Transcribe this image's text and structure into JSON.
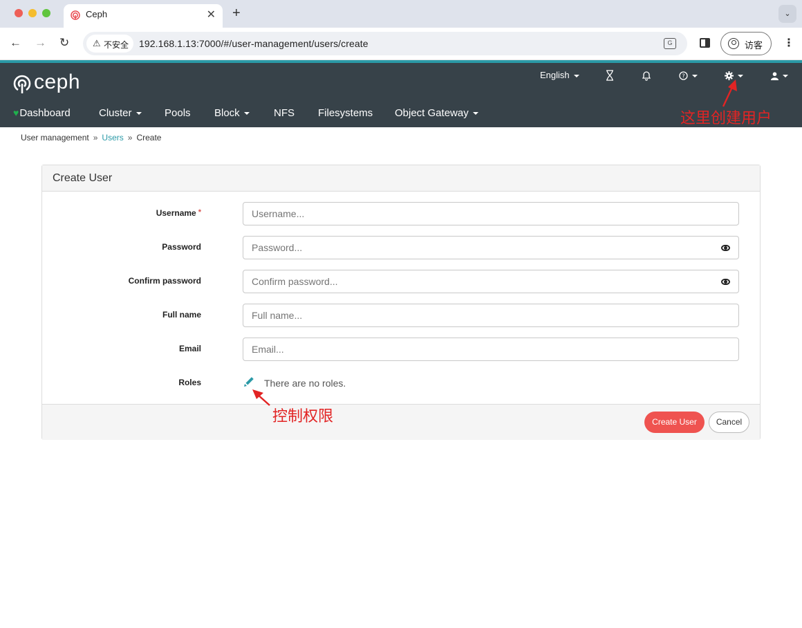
{
  "browser": {
    "tab_title": "Ceph",
    "tab_close": "✕",
    "new_tab": "+",
    "tab_search": "⌄",
    "back": "←",
    "forward": "→",
    "reload": "↻",
    "insecure_label": "不安全",
    "url": "192.168.1.13:7000/#/user-management/users/create",
    "guest_label": "访客",
    "menu": "⋮"
  },
  "header": {
    "logo_text": "ceph",
    "language": "English",
    "utility_icons": [
      "hourglass-icon",
      "bell-icon",
      "question-icon",
      "gear-icon",
      "user-icon"
    ],
    "nav": [
      {
        "label": "Dashboard",
        "dropdown": false
      },
      {
        "label": "Cluster",
        "dropdown": true
      },
      {
        "label": "Pools",
        "dropdown": false
      },
      {
        "label": "Block",
        "dropdown": true
      },
      {
        "label": "NFS",
        "dropdown": false
      },
      {
        "label": "Filesystems",
        "dropdown": false
      },
      {
        "label": "Object Gateway",
        "dropdown": true
      }
    ]
  },
  "annotations": {
    "create_user_here": "这里创建用户",
    "control_permissions": "控制权限",
    "color": "#e22424"
  },
  "breadcrumb": {
    "items": [
      "User management",
      "Users",
      "Create"
    ],
    "separator": "»"
  },
  "form": {
    "title": "Create User",
    "fields": {
      "username": {
        "label": "Username",
        "placeholder": "Username...",
        "required_mark": "*"
      },
      "password": {
        "label": "Password",
        "placeholder": "Password..."
      },
      "confirm_password": {
        "label": "Confirm password",
        "placeholder": "Confirm password..."
      },
      "full_name": {
        "label": "Full name",
        "placeholder": "Full name..."
      },
      "email": {
        "label": "Email",
        "placeholder": "Email..."
      },
      "roles": {
        "label": "Roles",
        "empty_text": "There are no roles."
      }
    },
    "submit_label": "Create User",
    "cancel_label": "Cancel"
  },
  "colors": {
    "header_bg": "#374249",
    "accent": "#2b9aa7",
    "primary_button": "#ef5350",
    "dashboard_heart": "#1fb14d"
  }
}
